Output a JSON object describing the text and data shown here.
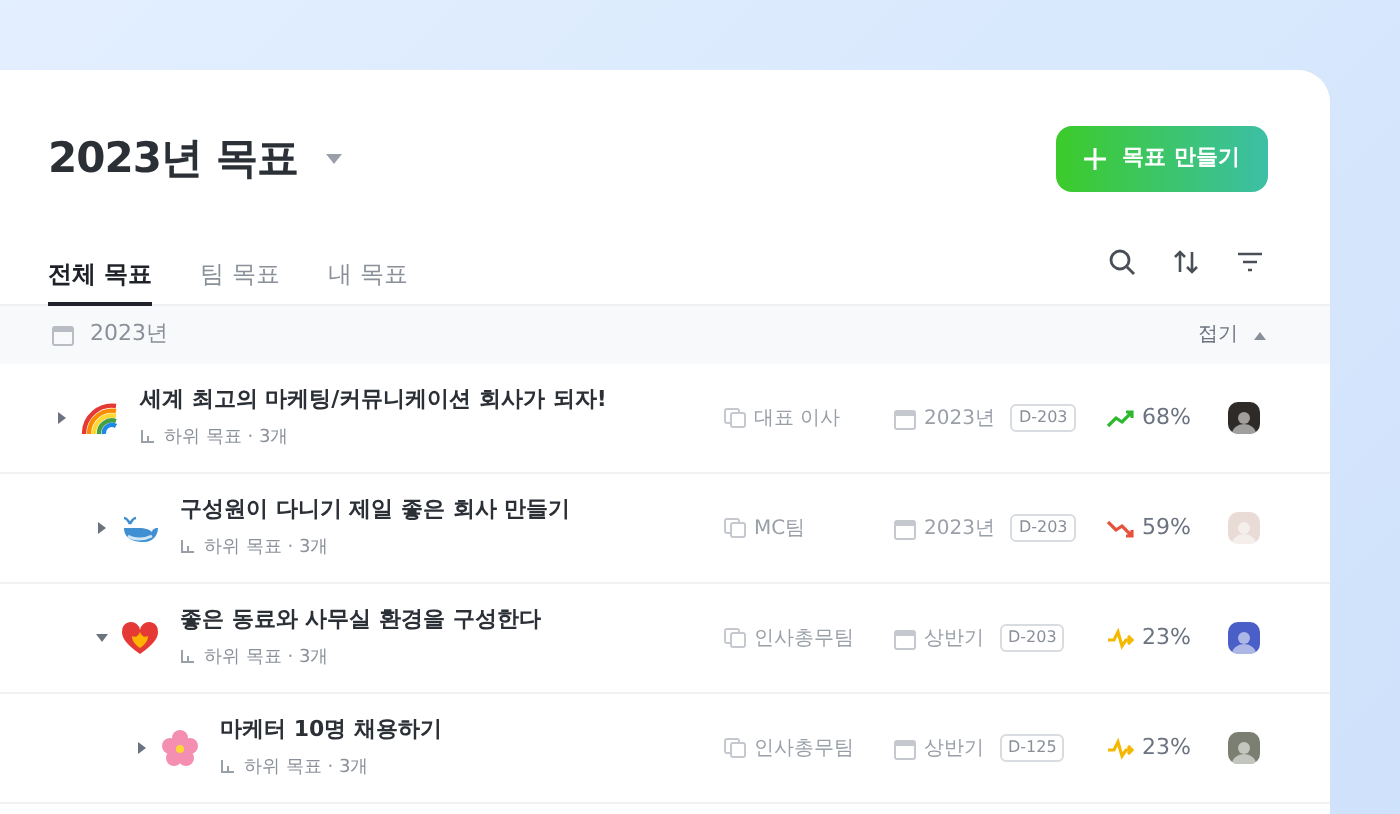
{
  "header": {
    "title": "2023년 목표",
    "create_button": "목표 만들기"
  },
  "tabs": [
    {
      "label": "전체 목표",
      "selected": true
    },
    {
      "label": "팀 목표",
      "selected": false
    },
    {
      "label": "내 목표",
      "selected": false
    }
  ],
  "group": {
    "label": "2023년",
    "collapse": "접기",
    "expanded": true
  },
  "goals": [
    {
      "title": "세계 최고의 마케팅/커뮤니케이션 회사가 되자!",
      "subgoals": "하위 목표 · 3개",
      "expanded": false,
      "owner": "대표 이사",
      "period": "2023년",
      "dday": "D-203",
      "kind": "up",
      "progress": "68%",
      "children": [
        {
          "title": "구성원이 다니기 제일 좋은 회사 만들기",
          "subgoals": "하위 목표 · 3개",
          "expanded": false,
          "owner": "MC팀",
          "period": "2023년",
          "dday": "D-203",
          "kind": "down",
          "progress": "59%"
        },
        {
          "title": "좋은 동료와 사무실 환경을 구성한다",
          "subgoals": "하위 목표 · 3개",
          "expanded": true,
          "owner": "인사총무팀",
          "period": "상반기",
          "dday": "D-203",
          "kind": "flat",
          "progress": "23%",
          "children": [
            {
              "title": "마케터 10명 채용하기",
              "subgoals": "하위 목표 · 3개",
              "expanded": false,
              "owner": "인사총무팀",
              "period": "상반기",
              "dday": "D-125",
              "kind": "flat",
              "progress": "23%"
            }
          ]
        }
      ]
    }
  ]
}
